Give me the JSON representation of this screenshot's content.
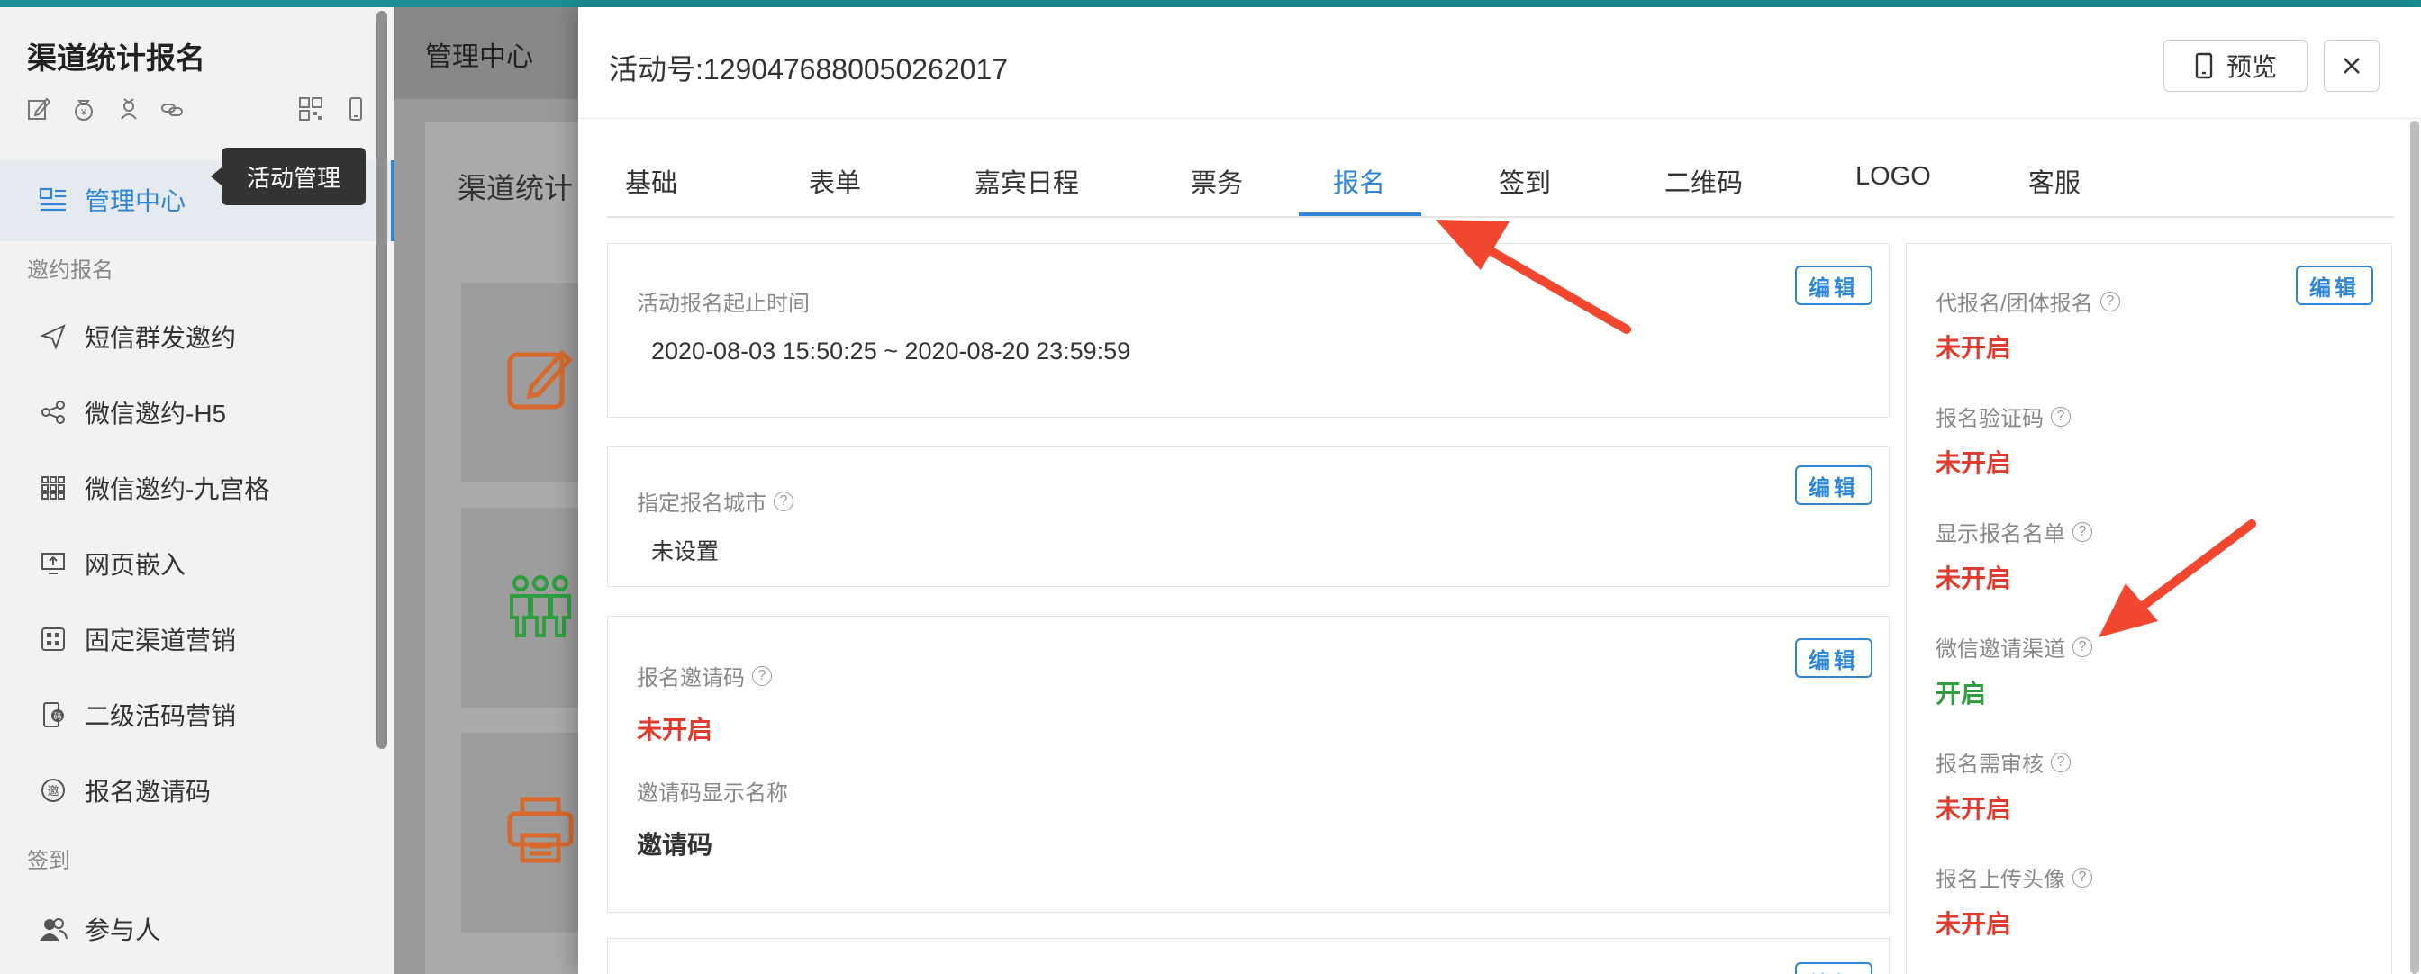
{
  "sidebar": {
    "app_title": "渠道统计报名",
    "active_item": "管理中心",
    "section_invite": "邀约报名",
    "items": [
      {
        "label": "短信群发邀约",
        "icon": "send-icon"
      },
      {
        "label": "微信邀约-H5",
        "icon": "share-icon"
      },
      {
        "label": "微信邀约-九宫格",
        "icon": "grid-icon"
      },
      {
        "label": "网页嵌入",
        "icon": "monitor-icon"
      },
      {
        "label": "固定渠道营销",
        "icon": "apps-icon"
      },
      {
        "label": "二级活码营销",
        "icon": "phone-code-icon"
      },
      {
        "label": "报名邀请码",
        "icon": "invite-code-icon"
      }
    ],
    "section_checkin": "签到",
    "participants": "参与人"
  },
  "tooltip": "活动管理",
  "background": {
    "header_title": "管理中心",
    "card_title": "渠道统计"
  },
  "dialog": {
    "title": "活动号:1290476880050262017",
    "preview_label": "预览",
    "tabs": [
      "基础",
      "表单",
      "嘉宾日程",
      "票务",
      "报名",
      "签到",
      "二维码",
      "LOGO",
      "客服"
    ],
    "active_tab": "报名",
    "edit_label": "编辑",
    "cards": {
      "time": {
        "label": "活动报名起止时间",
        "value": "2020-08-03 15:50:25 ~ 2020-08-20 23:59:59"
      },
      "city": {
        "label": "指定报名城市",
        "value": "未设置"
      },
      "invite": {
        "label": "报名邀请码",
        "value": "未开启",
        "name_label": "邀请码显示名称",
        "name_value": "邀请码"
      }
    },
    "right_settings": [
      {
        "label": "代报名/团体报名",
        "value": "未开启",
        "status": "off"
      },
      {
        "label": "报名验证码",
        "value": "未开启",
        "status": "off"
      },
      {
        "label": "显示报名名单",
        "value": "未开启",
        "status": "off"
      },
      {
        "label": "微信邀请渠道",
        "value": "开启",
        "status": "on"
      },
      {
        "label": "报名需审核",
        "value": "未开启",
        "status": "off"
      },
      {
        "label": "报名上传头像",
        "value": "未开启",
        "status": "off"
      }
    ]
  },
  "colors": {
    "accent": "#2f86d9",
    "off": "#e03b2d",
    "on": "#2e9e3e",
    "arrow": "#f0472e"
  }
}
